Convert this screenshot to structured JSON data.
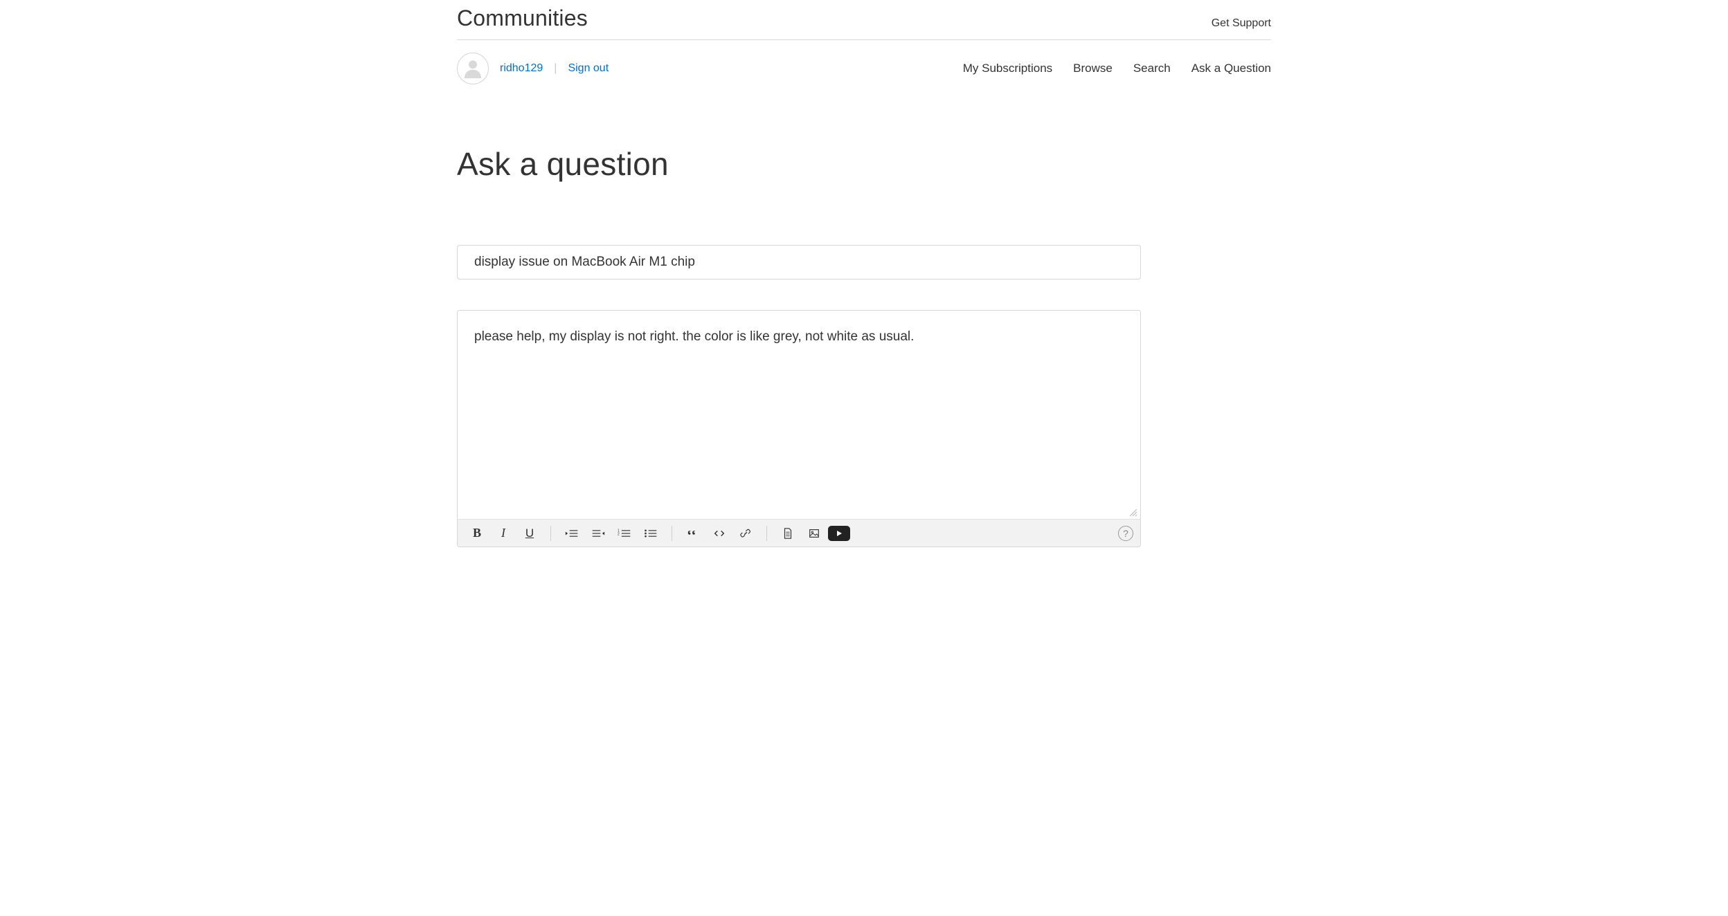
{
  "header": {
    "site_title": "Communities",
    "get_support": "Get Support"
  },
  "user": {
    "username": "ridho129",
    "signout_label": "Sign out"
  },
  "nav": {
    "items": [
      {
        "label": "My Subscriptions"
      },
      {
        "label": "Browse"
      },
      {
        "label": "Search"
      },
      {
        "label": "Ask a Question"
      }
    ]
  },
  "page": {
    "heading": "Ask a question"
  },
  "form": {
    "title_value": "display issue on MacBook Air M1 chip",
    "body_value": "please help, my display is not right. the color is like grey, not white as usual."
  },
  "toolbar": {
    "bold": "B",
    "italic": "I",
    "underline": "U",
    "help": "?"
  }
}
